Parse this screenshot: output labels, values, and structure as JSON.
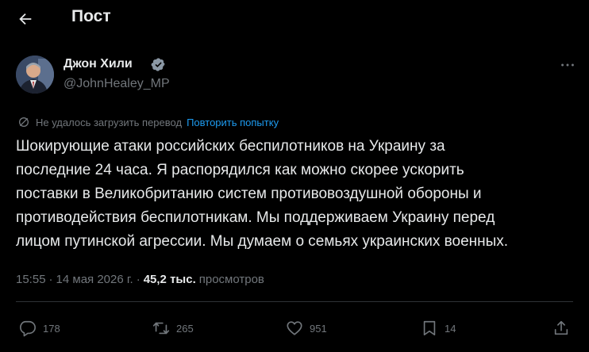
{
  "header": {
    "title": "Пост"
  },
  "post": {
    "author_name": "Джон Хили",
    "author_handle": "@JohnHealey_MP",
    "translation": {
      "failed_text": "Не удалось загрузить перевод",
      "retry_label": "Повторить попытку"
    },
    "text_lines": [
      "Шокирующие атаки российских беспилотников на Украину за",
      "последние 24 часа. Я распорядился как можно скорее ускорить",
      "поставки в Великобританию систем противовоздушной обороны и",
      "противодействия беспилотникам. Мы поддерживаем Украину перед",
      "лицом путинской агрессии. Мы думаем о семьях украинских военных."
    ],
    "time": "15:55",
    "date": "14 мая 2026 г.",
    "separator": "·",
    "views_count": "45,2 тыс.",
    "views_label": "просмотров"
  },
  "actions": {
    "replies": "178",
    "reposts": "265",
    "likes": "951",
    "bookmarks": "14"
  },
  "icons": {
    "back": "arrow-left-icon",
    "verified": "verified-badge-icon",
    "more": "more-horizontal-icon",
    "translate_failed": "translate-off-icon",
    "reply": "reply-icon",
    "repost": "repost-icon",
    "like": "heart-icon",
    "bookmark": "bookmark-icon",
    "share": "share-icon"
  },
  "colors": {
    "background": "#000000",
    "text": "#e7e9ea",
    "secondary": "#71767b",
    "accent": "#1d9bf0",
    "divider": "#2f3336"
  }
}
